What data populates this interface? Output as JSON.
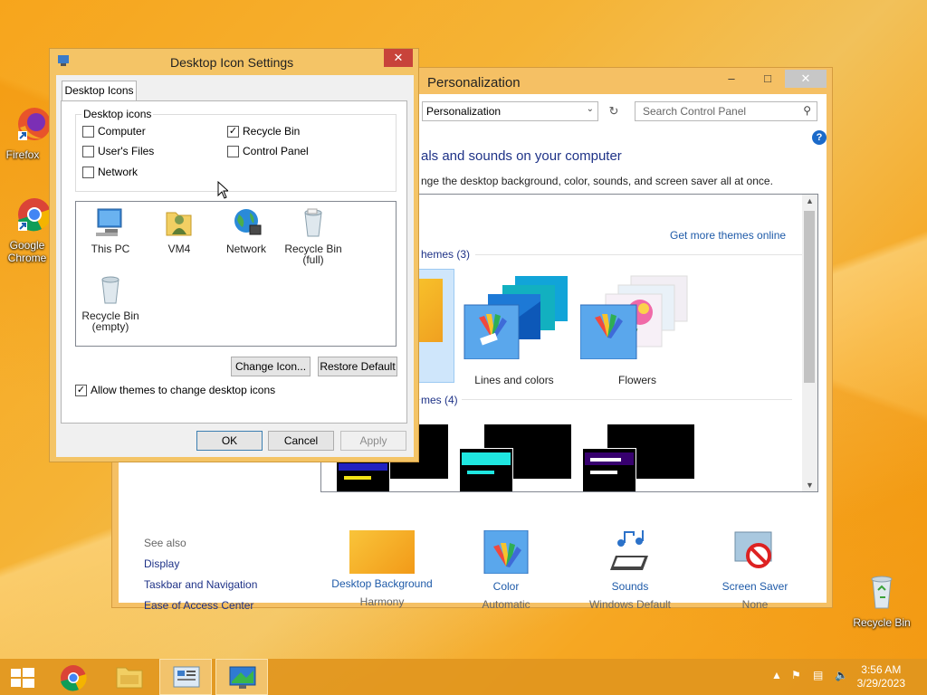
{
  "desktop": {
    "icons": [
      {
        "label": "Firefox"
      },
      {
        "label": "Google Chrome"
      },
      {
        "label": "Recycle Bin"
      }
    ]
  },
  "personalization": {
    "title": "Personalization",
    "controls": {
      "minimize": "–",
      "maximize": "□",
      "close": "✕"
    },
    "address": "Personalization",
    "search_placeholder": "Search Control Panel",
    "heading": "Change the visuals and sounds on your computer",
    "heading_visible": "als and sounds on your computer",
    "subheading_visible": "nge the desktop background, color, sounds, and screen saver all at once.",
    "get_more_themes": "Get more themes online",
    "installed_themes_label": "hemes (3)",
    "high_contrast_label": "mes (4)",
    "themes": [
      {
        "label": "Lines and colors"
      },
      {
        "label": "Flowers"
      }
    ],
    "see_also": {
      "title": "See also",
      "links": [
        "Display",
        "Taskbar and Navigation",
        "Ease of Access Center"
      ]
    },
    "bottom": [
      {
        "title": "Desktop Background",
        "sub": "Harmony"
      },
      {
        "title": "Color",
        "sub": "Automatic"
      },
      {
        "title": "Sounds",
        "sub": "Windows Default"
      },
      {
        "title": "Screen Saver",
        "sub": "None"
      }
    ]
  },
  "dialog": {
    "title": "Desktop Icon Settings",
    "close": "✕",
    "tab": "Desktop Icons",
    "group_title": "Desktop icons",
    "checkboxes": [
      {
        "label": "Computer",
        "checked": false
      },
      {
        "label": "Recycle Bin",
        "checked": true
      },
      {
        "label": "User's Files",
        "checked": false
      },
      {
        "label": "Control Panel",
        "checked": false
      },
      {
        "label": "Network",
        "checked": false
      }
    ],
    "icons": [
      {
        "label": "This PC"
      },
      {
        "label": "VM4"
      },
      {
        "label": "Network"
      },
      {
        "label": "Recycle Bin (full)",
        "line1": "Recycle Bin",
        "line2": "(full)"
      },
      {
        "label": "Recycle Bin (empty)",
        "line1": "Recycle Bin",
        "line2": "(empty)"
      }
    ],
    "change_icon": "Change Icon...",
    "restore_default": "Restore Default",
    "allow_themes": {
      "label": "Allow themes to change desktop icons",
      "checked": true
    },
    "ok": "OK",
    "cancel": "Cancel",
    "apply": "Apply"
  },
  "taskbar": {
    "time": "3:56 AM",
    "date": "3/29/2023"
  },
  "colors": {
    "accent_link": "#1e5aa8",
    "heading": "#1e3287",
    "window_frame": "#f4c466",
    "taskbar": "#e1961e"
  }
}
